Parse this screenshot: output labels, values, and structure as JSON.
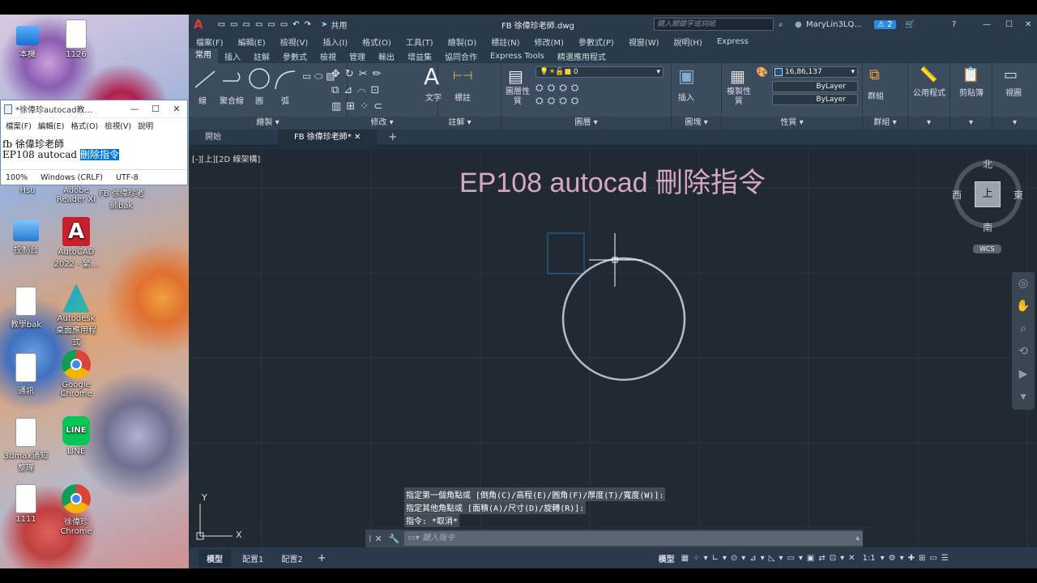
{
  "desktop": {
    "icons": [
      {
        "label": "本機",
        "icon": "computer-icon"
      },
      {
        "label": "1126",
        "icon": "document-icon"
      },
      {
        "label": "Hsu",
        "icon": "folder-icon"
      },
      {
        "label": "Adobe Reader XI",
        "icon": "adobe-reader-icon"
      },
      {
        "label": "FB 徐偉珍老師bak",
        "icon": "document-icon"
      },
      {
        "label": "控制台",
        "icon": "control-panel-icon"
      },
      {
        "label": "AutoCAD 2022 - 繁...",
        "icon": "autocad-icon"
      },
      {
        "label": "教學bak",
        "icon": "document-icon"
      },
      {
        "label": "Autodesk 桌面應用程式",
        "icon": "autodesk-icon"
      },
      {
        "label": "通訊",
        "icon": "document-icon"
      },
      {
        "label": "Google Chrome",
        "icon": "chrome-icon"
      },
      {
        "label": "3dmax通知整理",
        "icon": "document-icon"
      },
      {
        "label": "LINE",
        "icon": "line-icon"
      },
      {
        "label": "1111",
        "icon": "document-icon"
      },
      {
        "label": "徐偉珍 Chrome",
        "icon": "chrome-icon"
      }
    ]
  },
  "notepad": {
    "title": "*徐偉珍autocad教...",
    "menu": [
      "檔案(F)",
      "編輯(E)",
      "格式(O)",
      "檢視(V)",
      "說明"
    ],
    "line1": "fb 徐偉珍老師",
    "line2_prefix": "EP108 autocad ",
    "line2_selected": "刪除指令",
    "status": [
      "100%",
      "Windows (CRLF)",
      "UTF-8"
    ]
  },
  "app": {
    "quick_share": "共用",
    "file_title": "FB 徐偉珍老師.dwg",
    "search_placeholder": "鍵入關鍵字或詞組",
    "user": "MaryLin3LQ...",
    "notif_count": "2",
    "menus": [
      "檔案(F)",
      "編輯(E)",
      "檢視(V)",
      "插入(I)",
      "格式(O)",
      "工具(T)",
      "繪製(D)",
      "標註(N)",
      "修改(M)",
      "參數式(P)",
      "視窗(W)",
      "說明(H)",
      "Express"
    ],
    "ribbon_tabs": [
      "常用",
      "插入",
      "註解",
      "參數式",
      "檢視",
      "管理",
      "輸出",
      "增益集",
      "協同合作",
      "Express Tools",
      "精選應用程式"
    ],
    "draw_tools": [
      "線",
      "聚合線",
      "圓",
      "弧"
    ],
    "panels": [
      "繪製",
      "修改",
      "註解",
      "圖層",
      "圖塊",
      "性質",
      "群組",
      "公用程式",
      "剪貼簿",
      "視圖"
    ],
    "annot_tools": [
      "文字",
      "標註"
    ],
    "layer_tools": [
      "圖層性質"
    ],
    "layer_current": "0",
    "block_tool": "插入",
    "props_tool": "複製性質",
    "color_value": "16,86,137",
    "linetype": "ByLayer",
    "lineweight": "ByLayer",
    "group_tool": "群組",
    "doc_tabs": [
      "開始",
      "FB 徐偉珍老師*"
    ],
    "viewport_label": "[-][上][2D 線架構]",
    "overlay_title": "EP108 autocad 刪除指令",
    "viewcube": {
      "north": "北",
      "south": "南",
      "east": "東",
      "west": "西",
      "top": "上",
      "wcs": "WCS"
    },
    "command_history": [
      "指定第一個角點或 [倒角(C)/高程(E)/圓角(F)/厚度(T)/寬度(W)]:",
      "指定其他角點或 [面積(A)/尺寸(D)/旋轉(R)]:",
      "指令: *取消*"
    ],
    "command_placeholder": "鍵入指令",
    "layout_tabs": [
      "模型",
      "配置1",
      "配置2"
    ],
    "status_model": "模型",
    "status_scale": "1:1"
  },
  "colors": {
    "accent": "#0078d7",
    "canvas": "#212a33",
    "overlay_text": "#d6a6c8",
    "circle": "#b0bcc8"
  }
}
